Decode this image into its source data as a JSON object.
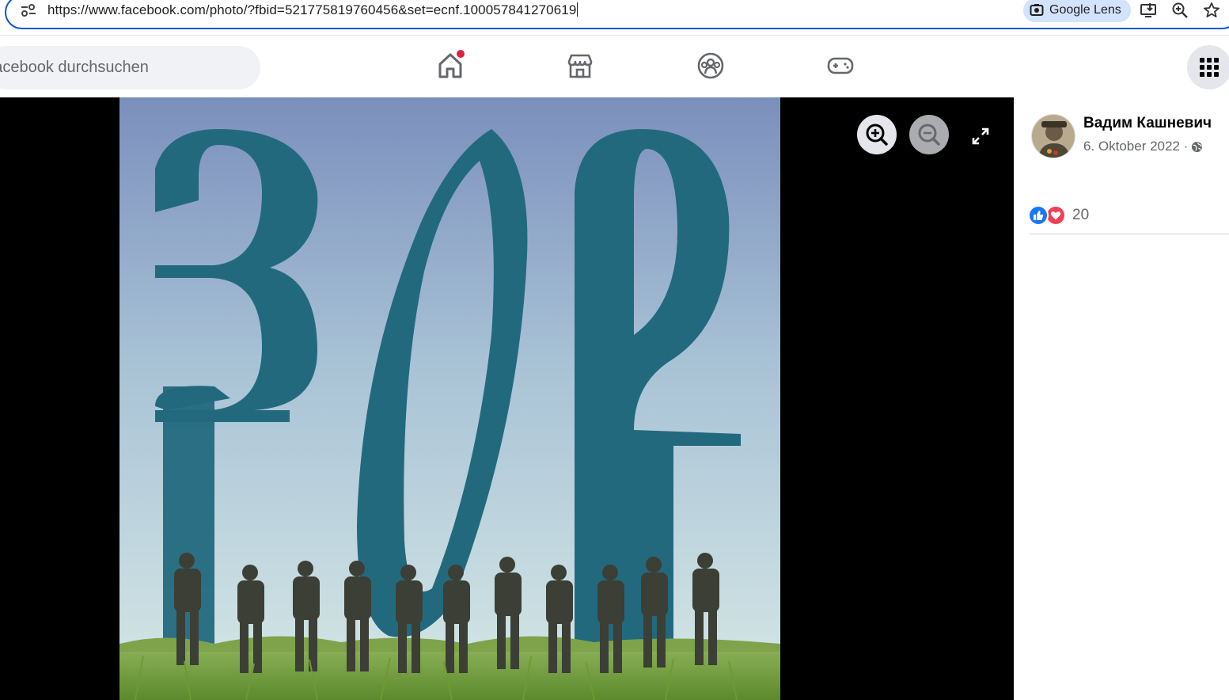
{
  "browser": {
    "url": "https://www.facebook.com/photo/?fbid=521775819760456&set=ecnf.100057841270619",
    "lens_label": "Google Lens",
    "icons": [
      "site-info-icon",
      "install-app-icon",
      "zoom-icon",
      "bookmark-star-icon"
    ]
  },
  "fb_nav": {
    "search_placeholder": "Facebook durchsuchen",
    "tabs": [
      {
        "name": "home",
        "icon": "home-icon",
        "has_notification": true
      },
      {
        "name": "marketplace",
        "icon": "marketplace-icon"
      },
      {
        "name": "groups",
        "icon": "groups-icon"
      },
      {
        "name": "gaming",
        "icon": "gaming-icon"
      }
    ],
    "menu_icon": "menu-grid-icon"
  },
  "viewer": {
    "controls": [
      "zoom-in-icon",
      "zoom-out-icon",
      "fullscreen-icon"
    ],
    "photo": {
      "overlay_text": "ЗОВ",
      "colors": {
        "sky_top": "#7d93bd",
        "sky_bottom": "#cfe3e6",
        "letters": "#21687d",
        "grass": "#6f9a3a"
      }
    }
  },
  "post": {
    "author": "Вадим Кашневич",
    "date": "6. Oktober 2022 ·",
    "privacy_icon": "globe-icon",
    "reaction_icons": [
      "like-icon",
      "love-icon"
    ],
    "reaction_count": "20"
  },
  "colors": {
    "brand": "#1877f2",
    "accent_outline": "#0b57d0",
    "notification": "#e41e3f"
  }
}
